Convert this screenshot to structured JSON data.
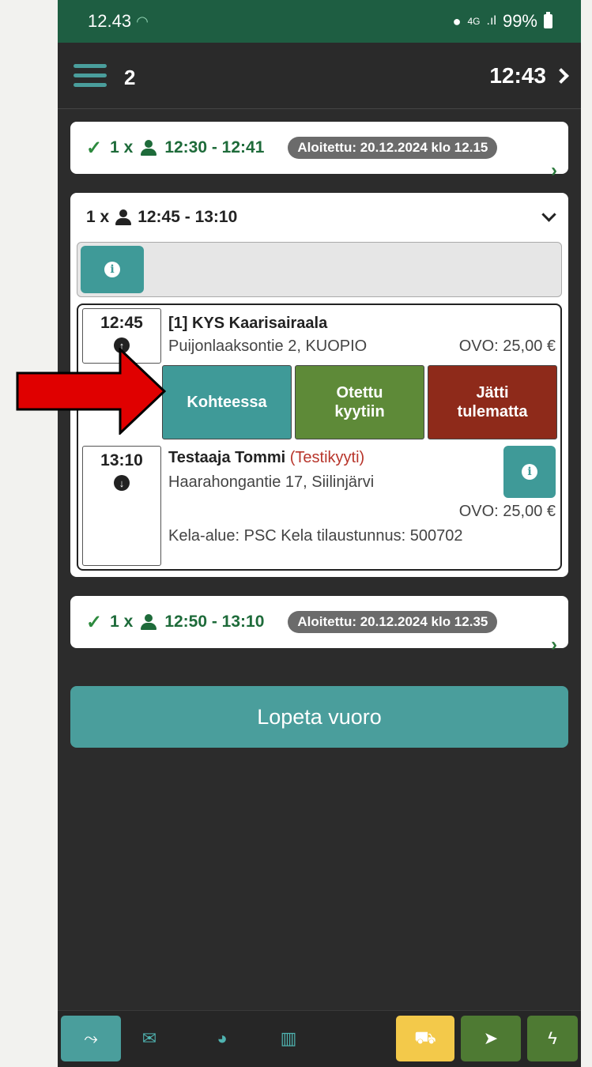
{
  "status_bar": {
    "time": "12.43",
    "network": "4G",
    "battery": "99%"
  },
  "app_bar": {
    "trip_count": "2",
    "current_time": "12:43"
  },
  "trips": {
    "first": {
      "count": "1 x",
      "time_range": "12:30 - 12:41",
      "status": "Aloitettu: 20.12.2024 klo 12.15"
    },
    "active": {
      "count": "1 x",
      "time_range": "12:45 - 13:10",
      "pickup": {
        "time": "12:45",
        "title": "[1] KYS Kaarisairaala",
        "address": "Puijonlaaksontie 2, KUOPIO",
        "ovo": "OVO: 25,00 €"
      },
      "actions": {
        "arrived": "Kohteessa",
        "picked_up_line1": "Otettu",
        "picked_up_line2": "kyytiin",
        "no_show_line1": "Jätti",
        "no_show_line2": "tulematta"
      },
      "dropoff": {
        "time": "13:10",
        "name": "Testaaja Tommi",
        "tag": "(Testikyyti)",
        "address": "Haarahongantie 17, Siilinjärvi",
        "ovo": "OVO: 25,00 €",
        "kela": "Kela-alue: PSC Kela tilaustunnus: 500702"
      }
    },
    "third": {
      "count": "1 x",
      "time_range": "12:50 - 13:10",
      "status": "Aloitettu: 20.12.2024 klo 12.35"
    }
  },
  "end_shift_label": "Lopeta vuoro",
  "colors": {
    "teal": "#3f9a98",
    "green": "#5e8a38",
    "red": "#8e2a1a",
    "yellow": "#f3c94a",
    "statusbar": "#1e5e42"
  },
  "icons": [
    "menu-icon",
    "chevron-right-icon",
    "check-icon",
    "person-icon",
    "chevron-down-icon",
    "info-icon",
    "arrow-up-icon",
    "arrow-down-icon",
    "route-icon",
    "mail-icon",
    "dashboard-icon",
    "map-icon",
    "car-icon",
    "navigation-icon",
    "bolt-icon"
  ]
}
